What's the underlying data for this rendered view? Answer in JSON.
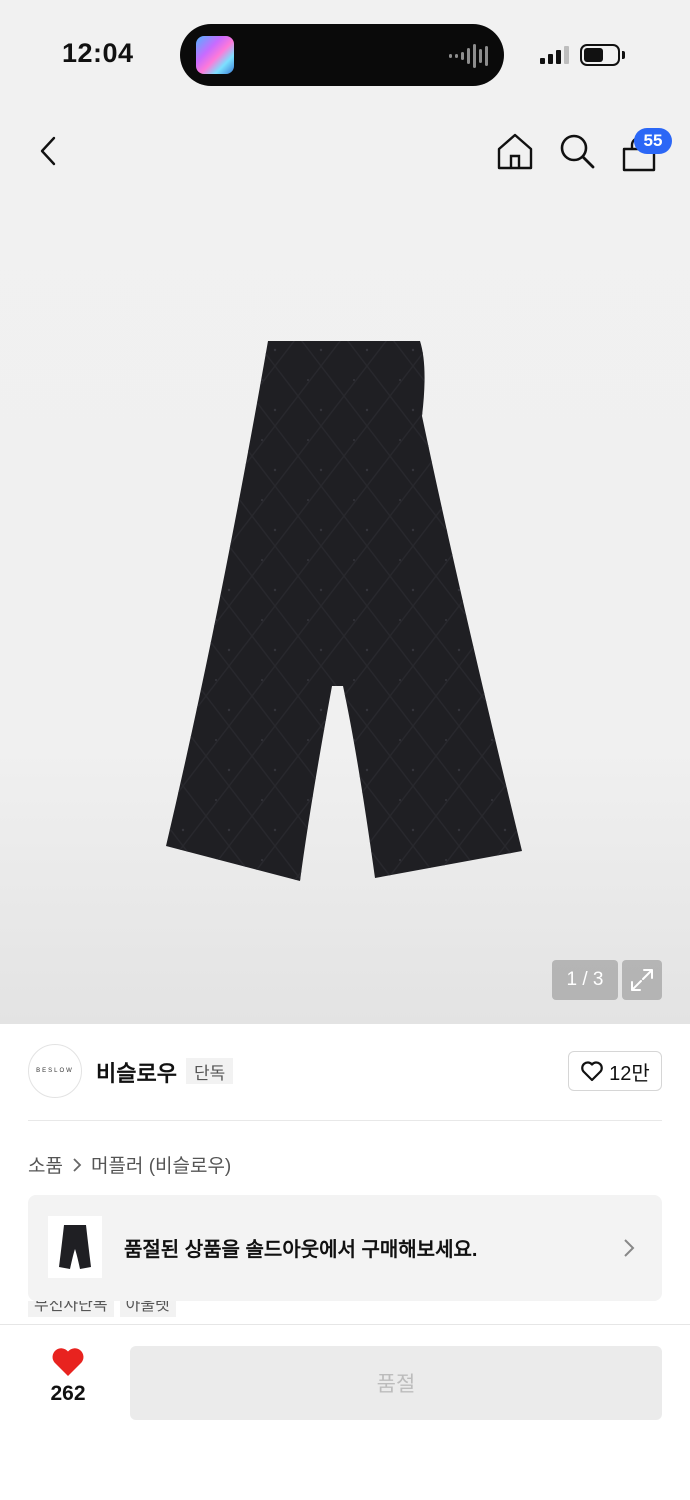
{
  "status_bar": {
    "time": "12:04"
  },
  "header": {
    "cart_count": "55"
  },
  "gallery": {
    "page_indicator": "1 / 3"
  },
  "brand": {
    "logo_text": "BESLOW",
    "name": "비슬로우",
    "exclusive_label": "단독",
    "like_count": "12만"
  },
  "breadcrumb": {
    "category": "소품",
    "product": "머플러 (비슬로우)"
  },
  "soldout_banner": {
    "text": "품절된 상품을 솔드아웃에서 구매해보세요."
  },
  "tags": [
    "무신사단독",
    "아울렛"
  ],
  "bottom_bar": {
    "wish_count": "262",
    "buy_label": "품절"
  },
  "colors": {
    "accent_blue": "#2b67f6",
    "heart_red": "#e8231f",
    "product_black": "#1f1f23"
  },
  "icons": [
    "back-icon",
    "home-icon",
    "search-icon",
    "cart-icon",
    "expand-icon",
    "heart-outline-icon",
    "chevron-right-icon",
    "heart-filled-icon"
  ]
}
